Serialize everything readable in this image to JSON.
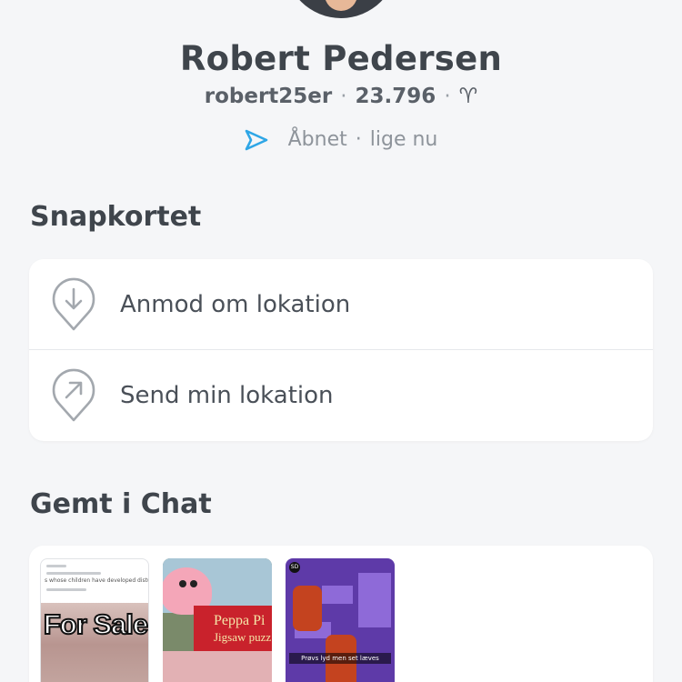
{
  "profile": {
    "name": "Robert Pedersen",
    "username": "robert25er",
    "score": "23.796",
    "zodiac": "♈",
    "status_action": "Åbnet",
    "status_time": "lige nu",
    "separator": "·"
  },
  "snap_map": {
    "title": "Snapkortet",
    "items": [
      {
        "label": "Anmod om lokation",
        "icon": "location-request-icon"
      },
      {
        "label": "Send min lokation",
        "icon": "location-send-icon"
      }
    ]
  },
  "saved_in_chat": {
    "title": "Gemt i Chat",
    "thumbs": [
      {
        "text": "For Sale",
        "line": "s whose children have developed disturb"
      },
      {
        "text": "Peppa Pi",
        "text2": "Jigsaw puzz"
      },
      {
        "text": "Prøvs lyd men set læves",
        "badge": "SD"
      }
    ]
  },
  "colors": {
    "accent": "#2ea6e6",
    "background": "#f5f6f8",
    "card": "#ffffff"
  }
}
